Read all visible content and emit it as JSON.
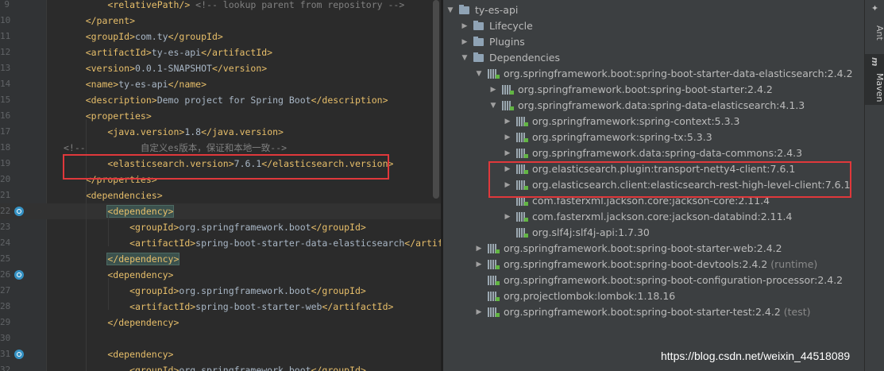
{
  "editor": {
    "lines": [
      {
        "n": "9",
        "parts": [
          {
            "c": "tag",
            "t": "        <relativePath/>"
          },
          {
            "c": "cmt",
            "t": " <!-- lookup parent from repository -->"
          }
        ]
      },
      {
        "n": "10",
        "parts": [
          {
            "c": "tag",
            "t": "    </parent>"
          }
        ]
      },
      {
        "n": "11",
        "parts": [
          {
            "c": "tag",
            "t": "    <groupId>"
          },
          {
            "c": "txt",
            "t": "com.ty"
          },
          {
            "c": "tag",
            "t": "</groupId>"
          }
        ]
      },
      {
        "n": "12",
        "parts": [
          {
            "c": "tag",
            "t": "    <artifactId>"
          },
          {
            "c": "txt",
            "t": "ty-es-api"
          },
          {
            "c": "tag",
            "t": "</artifactId>"
          }
        ]
      },
      {
        "n": "13",
        "parts": [
          {
            "c": "tag",
            "t": "    <version>"
          },
          {
            "c": "txt",
            "t": "0.0.1-SNAPSHOT"
          },
          {
            "c": "tag",
            "t": "</version>"
          }
        ]
      },
      {
        "n": "14",
        "parts": [
          {
            "c": "tag",
            "t": "    <name>"
          },
          {
            "c": "txt",
            "t": "ty-es-api"
          },
          {
            "c": "tag",
            "t": "</name>"
          }
        ]
      },
      {
        "n": "15",
        "parts": [
          {
            "c": "tag",
            "t": "    <description>"
          },
          {
            "c": "txt",
            "t": "Demo project for Spring Boot"
          },
          {
            "c": "tag",
            "t": "</description>"
          }
        ]
      },
      {
        "n": "16",
        "parts": [
          {
            "c": "tag",
            "t": "    <properties>"
          }
        ]
      },
      {
        "n": "17",
        "parts": [
          {
            "c": "tag",
            "t": "        <java.version>"
          },
          {
            "c": "txt",
            "t": "1.8"
          },
          {
            "c": "tag",
            "t": "</java.version>"
          }
        ]
      },
      {
        "n": "18",
        "parts": [
          {
            "c": "cmt",
            "t": "<!--          自定义es版本，保证和本地一致-->"
          }
        ]
      },
      {
        "n": "19",
        "parts": [
          {
            "c": "tag",
            "t": "        <elasticsearch.version>"
          },
          {
            "c": "txt",
            "t": "7.6.1"
          },
          {
            "c": "tag",
            "t": "</elasticsearch.version>"
          }
        ]
      },
      {
        "n": "20",
        "parts": [
          {
            "c": "tag",
            "t": "    </properties>"
          }
        ]
      },
      {
        "n": "21",
        "parts": [
          {
            "c": "tag",
            "t": "    <dependencies>"
          }
        ]
      },
      {
        "n": "22",
        "hl": true,
        "icon": true,
        "parts": [
          {
            "c": "tag",
            "t": "        "
          },
          {
            "c": "tag tagbox",
            "t": "<dependency>"
          }
        ]
      },
      {
        "n": "23",
        "parts": [
          {
            "c": "tag",
            "t": "            <groupId>"
          },
          {
            "c": "txt",
            "t": "org.springframework.boot"
          },
          {
            "c": "tag",
            "t": "</groupId>"
          }
        ]
      },
      {
        "n": "24",
        "parts": [
          {
            "c": "tag",
            "t": "            <artifactId>"
          },
          {
            "c": "txt",
            "t": "spring-boot-starter-data-elasticsearch"
          },
          {
            "c": "tag",
            "t": "</artifact"
          }
        ]
      },
      {
        "n": "25",
        "parts": [
          {
            "c": "tag",
            "t": "        "
          },
          {
            "c": "tag tagbox",
            "t": "</dependency>"
          }
        ]
      },
      {
        "n": "26",
        "icon": true,
        "parts": [
          {
            "c": "tag",
            "t": "        <dependency>"
          }
        ]
      },
      {
        "n": "27",
        "parts": [
          {
            "c": "tag",
            "t": "            <groupId>"
          },
          {
            "c": "txt",
            "t": "org.springframework.boot"
          },
          {
            "c": "tag",
            "t": "</groupId>"
          }
        ]
      },
      {
        "n": "28",
        "parts": [
          {
            "c": "tag",
            "t": "            <artifactId>"
          },
          {
            "c": "txt",
            "t": "spring-boot-starter-web"
          },
          {
            "c": "tag",
            "t": "</artifactId>"
          }
        ]
      },
      {
        "n": "29",
        "parts": [
          {
            "c": "tag",
            "t": "        </dependency>"
          }
        ]
      },
      {
        "n": "30",
        "parts": []
      },
      {
        "n": "31",
        "icon": true,
        "parts": [
          {
            "c": "tag",
            "t": "        <dependency>"
          }
        ]
      },
      {
        "n": "32",
        "parts": [
          {
            "c": "tag",
            "t": "            <groupId>"
          },
          {
            "c": "txt",
            "t": "org.springframework.boot"
          },
          {
            "c": "tag",
            "t": "</groupId>"
          }
        ]
      }
    ]
  },
  "maven": {
    "nodes": [
      {
        "depth": 0,
        "arrow": "▼",
        "icon": "folder",
        "label": "ty-es-api",
        "scope": ""
      },
      {
        "depth": 1,
        "arrow": "▶",
        "icon": "folder",
        "label": "Lifecycle",
        "scope": ""
      },
      {
        "depth": 1,
        "arrow": "▶",
        "icon": "folder",
        "label": "Plugins",
        "scope": ""
      },
      {
        "depth": 1,
        "arrow": "▼",
        "icon": "folder",
        "label": "Dependencies",
        "scope": ""
      },
      {
        "depth": 2,
        "arrow": "▼",
        "icon": "bars",
        "label": "org.springframework.boot:spring-boot-starter-data-elasticsearch:2.4.2",
        "scope": ""
      },
      {
        "depth": 3,
        "arrow": "▶",
        "icon": "bars",
        "label": "org.springframework.boot:spring-boot-starter:2.4.2",
        "scope": ""
      },
      {
        "depth": 3,
        "arrow": "▼",
        "icon": "bars",
        "label": "org.springframework.data:spring-data-elasticsearch:4.1.3",
        "scope": ""
      },
      {
        "depth": 4,
        "arrow": "▶",
        "icon": "bars",
        "label": "org.springframework:spring-context:5.3.3",
        "scope": ""
      },
      {
        "depth": 4,
        "arrow": "▶",
        "icon": "bars",
        "label": "org.springframework:spring-tx:5.3.3",
        "scope": ""
      },
      {
        "depth": 4,
        "arrow": "▶",
        "icon": "bars",
        "label": "org.springframework.data:spring-data-commons:2.4.3",
        "scope": ""
      },
      {
        "depth": 4,
        "arrow": "▶",
        "icon": "bars",
        "label": "org.elasticsearch.plugin:transport-netty4-client:7.6.1",
        "scope": ""
      },
      {
        "depth": 4,
        "arrow": "▶",
        "icon": "bars",
        "label": "org.elasticsearch.client:elasticsearch-rest-high-level-client:7.6.1",
        "scope": ""
      },
      {
        "depth": 4,
        "arrow": "",
        "icon": "bars",
        "label": "com.fasterxml.jackson.core:jackson-core:2.11.4",
        "scope": ""
      },
      {
        "depth": 4,
        "arrow": "▶",
        "icon": "bars",
        "label": "com.fasterxml.jackson.core:jackson-databind:2.11.4",
        "scope": ""
      },
      {
        "depth": 4,
        "arrow": "",
        "icon": "bars",
        "label": "org.slf4j:slf4j-api:1.7.30",
        "scope": ""
      },
      {
        "depth": 2,
        "arrow": "▶",
        "icon": "bars",
        "label": "org.springframework.boot:spring-boot-starter-web:2.4.2",
        "scope": ""
      },
      {
        "depth": 2,
        "arrow": "▶",
        "icon": "bars",
        "label": "org.springframework.boot:spring-boot-devtools:2.4.2",
        "scope": "(runtime)"
      },
      {
        "depth": 2,
        "arrow": "",
        "icon": "bars",
        "label": "org.springframework.boot:spring-boot-configuration-processor:2.4.2",
        "scope": ""
      },
      {
        "depth": 2,
        "arrow": "",
        "icon": "bars",
        "label": "org.projectlombok:lombok:1.18.16",
        "scope": ""
      },
      {
        "depth": 2,
        "arrow": "▶",
        "icon": "bars",
        "label": "org.springframework.boot:spring-boot-starter-test:2.4.2",
        "scope": "(test)"
      }
    ]
  },
  "stripe": {
    "ant_label": "Ant",
    "maven_label": "Maven",
    "maven_glyph": "m"
  },
  "watermark": "https://blog.csdn.net/weixin_44518089",
  "colors": {
    "highlight_box": "#e0383b",
    "tag": "#e8bf6a",
    "text": "#a9b7c6"
  }
}
